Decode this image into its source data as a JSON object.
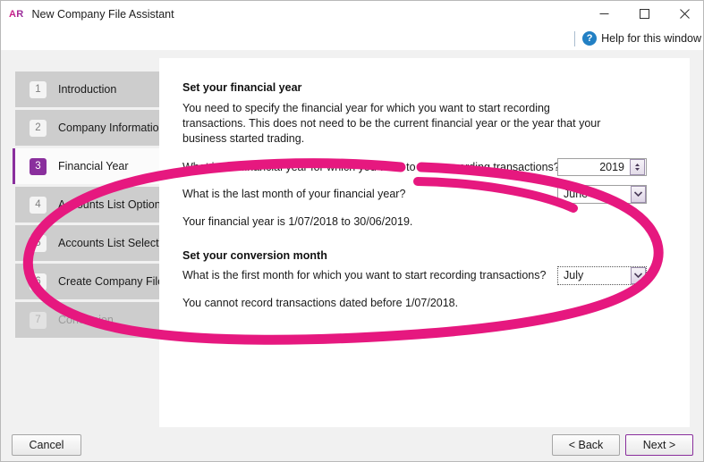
{
  "window": {
    "logo_text": "AR",
    "title": "New Company File Assistant",
    "controls": {
      "minimize": "minimize-icon",
      "maximize": "maximize-icon",
      "close": "close-icon"
    }
  },
  "help": {
    "icon": "help-circle-icon",
    "label": "Help for this window"
  },
  "sidebar": {
    "items": [
      {
        "num": "1",
        "label": "Introduction",
        "state": "done"
      },
      {
        "num": "2",
        "label": "Company Information",
        "state": "done"
      },
      {
        "num": "3",
        "label": "Financial Year",
        "state": "active"
      },
      {
        "num": "4",
        "label": "Accounts List Options",
        "state": "done"
      },
      {
        "num": "5",
        "label": "Accounts List Selection",
        "state": "done"
      },
      {
        "num": "6",
        "label": "Create Company File",
        "state": "done"
      },
      {
        "num": "7",
        "label": "Conclusion",
        "state": "disabled"
      }
    ]
  },
  "content": {
    "financial_year": {
      "heading": "Set your financial year",
      "description": "You need to specify the financial year for which you want to start recording transactions. This does not need to be the current financial year or the year that your business started trading.",
      "year_question": "What is the financial year for which you want to start recording transactions?",
      "year_value": "2019",
      "last_month_question": "What is the last month of your financial year?",
      "last_month_value": "June",
      "summary": "Your financial year is 1/07/2018 to 30/06/2019."
    },
    "conversion_month": {
      "heading": "Set your conversion month",
      "question": "What is the first month for which you want to start recording transactions?",
      "value": "July",
      "note": "You cannot record transactions dated before 1/07/2018."
    }
  },
  "footer": {
    "cancel_label": "Cancel",
    "back_label": "< Back",
    "next_label": "Next >"
  },
  "annotation": {
    "shape": "hand-drawn-ellipse",
    "color": "#E6187F"
  },
  "colors": {
    "accent_purple": "#8A2F9D",
    "annotation_pink": "#E6187F",
    "help_blue": "#2280C4"
  }
}
